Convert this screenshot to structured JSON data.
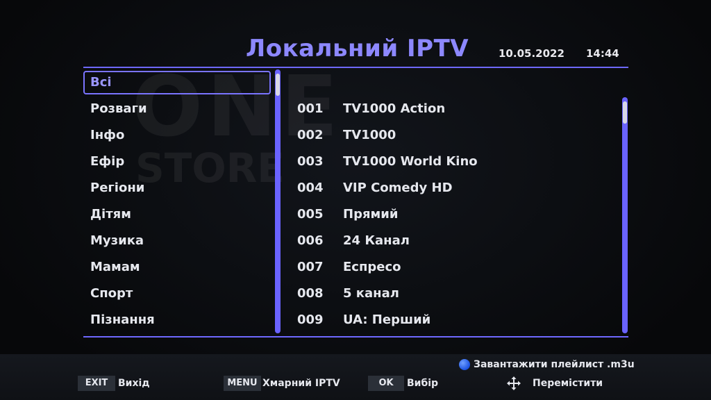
{
  "header": {
    "title": "Локальний IPTV",
    "date": "10.05.2022",
    "time": "14:44"
  },
  "watermark": {
    "line1": "ONE",
    "line2": "STORE"
  },
  "categories": [
    {
      "label": "Всі",
      "selected": true
    },
    {
      "label": "Розваги"
    },
    {
      "label": "Інфо"
    },
    {
      "label": "Ефір"
    },
    {
      "label": "Регіони"
    },
    {
      "label": "Дітям"
    },
    {
      "label": "Музика"
    },
    {
      "label": "Мамам"
    },
    {
      "label": "Спорт"
    },
    {
      "label": "Пізнання"
    }
  ],
  "channels": [
    {
      "num": "001",
      "name": "TV1000 Action"
    },
    {
      "num": "002",
      "name": "TV1000"
    },
    {
      "num": "003",
      "name": "TV1000 World Kino"
    },
    {
      "num": "004",
      "name": "VIP Comedy HD"
    },
    {
      "num": "005",
      "name": "Прямий"
    },
    {
      "num": "006",
      "name": "24 Канал"
    },
    {
      "num": "007",
      "name": "Еспресо"
    },
    {
      "num": "008",
      "name": "5 канал"
    },
    {
      "num": "009",
      "name": "UA: Перший"
    }
  ],
  "footer": {
    "blue_action": "Завантажити плейлист .m3u",
    "exit_key": "EXIT",
    "exit_label": "Вихід",
    "menu_key": "MENU",
    "menu_label": "Хмарний IPTV",
    "ok_key": "OK",
    "ok_label": "Вибір",
    "move_label": "Перемістити",
    "move_icon": "move-arrows-icon",
    "blue_icon": "blue-button-icon"
  },
  "colors": {
    "accent": "#7a74ff",
    "title": "#8d88ff",
    "background": "#0b0d10"
  }
}
